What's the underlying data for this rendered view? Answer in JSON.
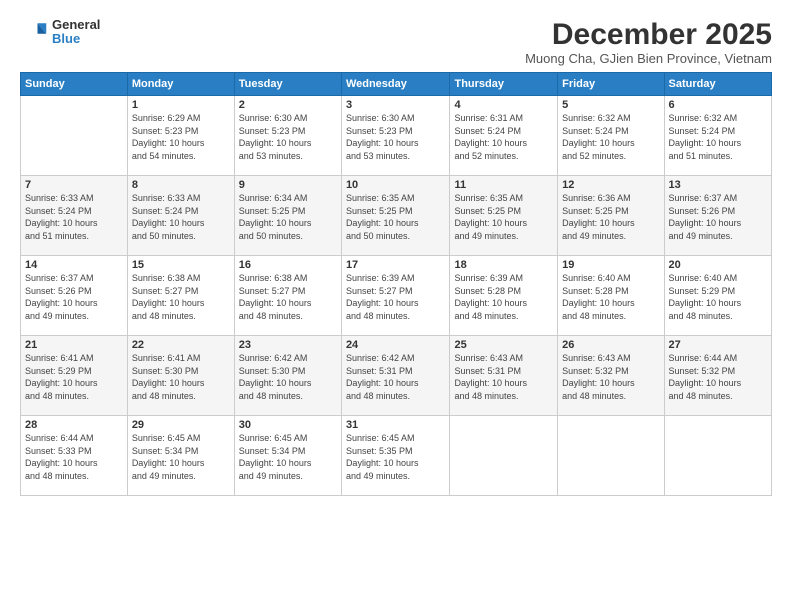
{
  "logo": {
    "general": "General",
    "blue": "Blue"
  },
  "title": "December 2025",
  "subtitle": "Muong Cha, GJien Bien Province, Vietnam",
  "weekdays": [
    "Sunday",
    "Monday",
    "Tuesday",
    "Wednesday",
    "Thursday",
    "Friday",
    "Saturday"
  ],
  "weeks": [
    [
      {
        "num": "",
        "info": ""
      },
      {
        "num": "1",
        "info": "Sunrise: 6:29 AM\nSunset: 5:23 PM\nDaylight: 10 hours\nand 54 minutes."
      },
      {
        "num": "2",
        "info": "Sunrise: 6:30 AM\nSunset: 5:23 PM\nDaylight: 10 hours\nand 53 minutes."
      },
      {
        "num": "3",
        "info": "Sunrise: 6:30 AM\nSunset: 5:23 PM\nDaylight: 10 hours\nand 53 minutes."
      },
      {
        "num": "4",
        "info": "Sunrise: 6:31 AM\nSunset: 5:24 PM\nDaylight: 10 hours\nand 52 minutes."
      },
      {
        "num": "5",
        "info": "Sunrise: 6:32 AM\nSunset: 5:24 PM\nDaylight: 10 hours\nand 52 minutes."
      },
      {
        "num": "6",
        "info": "Sunrise: 6:32 AM\nSunset: 5:24 PM\nDaylight: 10 hours\nand 51 minutes."
      }
    ],
    [
      {
        "num": "7",
        "info": "Sunrise: 6:33 AM\nSunset: 5:24 PM\nDaylight: 10 hours\nand 51 minutes."
      },
      {
        "num": "8",
        "info": "Sunrise: 6:33 AM\nSunset: 5:24 PM\nDaylight: 10 hours\nand 50 minutes."
      },
      {
        "num": "9",
        "info": "Sunrise: 6:34 AM\nSunset: 5:25 PM\nDaylight: 10 hours\nand 50 minutes."
      },
      {
        "num": "10",
        "info": "Sunrise: 6:35 AM\nSunset: 5:25 PM\nDaylight: 10 hours\nand 50 minutes."
      },
      {
        "num": "11",
        "info": "Sunrise: 6:35 AM\nSunset: 5:25 PM\nDaylight: 10 hours\nand 49 minutes."
      },
      {
        "num": "12",
        "info": "Sunrise: 6:36 AM\nSunset: 5:25 PM\nDaylight: 10 hours\nand 49 minutes."
      },
      {
        "num": "13",
        "info": "Sunrise: 6:37 AM\nSunset: 5:26 PM\nDaylight: 10 hours\nand 49 minutes."
      }
    ],
    [
      {
        "num": "14",
        "info": "Sunrise: 6:37 AM\nSunset: 5:26 PM\nDaylight: 10 hours\nand 49 minutes."
      },
      {
        "num": "15",
        "info": "Sunrise: 6:38 AM\nSunset: 5:27 PM\nDaylight: 10 hours\nand 48 minutes."
      },
      {
        "num": "16",
        "info": "Sunrise: 6:38 AM\nSunset: 5:27 PM\nDaylight: 10 hours\nand 48 minutes."
      },
      {
        "num": "17",
        "info": "Sunrise: 6:39 AM\nSunset: 5:27 PM\nDaylight: 10 hours\nand 48 minutes."
      },
      {
        "num": "18",
        "info": "Sunrise: 6:39 AM\nSunset: 5:28 PM\nDaylight: 10 hours\nand 48 minutes."
      },
      {
        "num": "19",
        "info": "Sunrise: 6:40 AM\nSunset: 5:28 PM\nDaylight: 10 hours\nand 48 minutes."
      },
      {
        "num": "20",
        "info": "Sunrise: 6:40 AM\nSunset: 5:29 PM\nDaylight: 10 hours\nand 48 minutes."
      }
    ],
    [
      {
        "num": "21",
        "info": "Sunrise: 6:41 AM\nSunset: 5:29 PM\nDaylight: 10 hours\nand 48 minutes."
      },
      {
        "num": "22",
        "info": "Sunrise: 6:41 AM\nSunset: 5:30 PM\nDaylight: 10 hours\nand 48 minutes."
      },
      {
        "num": "23",
        "info": "Sunrise: 6:42 AM\nSunset: 5:30 PM\nDaylight: 10 hours\nand 48 minutes."
      },
      {
        "num": "24",
        "info": "Sunrise: 6:42 AM\nSunset: 5:31 PM\nDaylight: 10 hours\nand 48 minutes."
      },
      {
        "num": "25",
        "info": "Sunrise: 6:43 AM\nSunset: 5:31 PM\nDaylight: 10 hours\nand 48 minutes."
      },
      {
        "num": "26",
        "info": "Sunrise: 6:43 AM\nSunset: 5:32 PM\nDaylight: 10 hours\nand 48 minutes."
      },
      {
        "num": "27",
        "info": "Sunrise: 6:44 AM\nSunset: 5:32 PM\nDaylight: 10 hours\nand 48 minutes."
      }
    ],
    [
      {
        "num": "28",
        "info": "Sunrise: 6:44 AM\nSunset: 5:33 PM\nDaylight: 10 hours\nand 48 minutes."
      },
      {
        "num": "29",
        "info": "Sunrise: 6:45 AM\nSunset: 5:34 PM\nDaylight: 10 hours\nand 49 minutes."
      },
      {
        "num": "30",
        "info": "Sunrise: 6:45 AM\nSunset: 5:34 PM\nDaylight: 10 hours\nand 49 minutes."
      },
      {
        "num": "31",
        "info": "Sunrise: 6:45 AM\nSunset: 5:35 PM\nDaylight: 10 hours\nand 49 minutes."
      },
      {
        "num": "",
        "info": ""
      },
      {
        "num": "",
        "info": ""
      },
      {
        "num": "",
        "info": ""
      }
    ]
  ]
}
